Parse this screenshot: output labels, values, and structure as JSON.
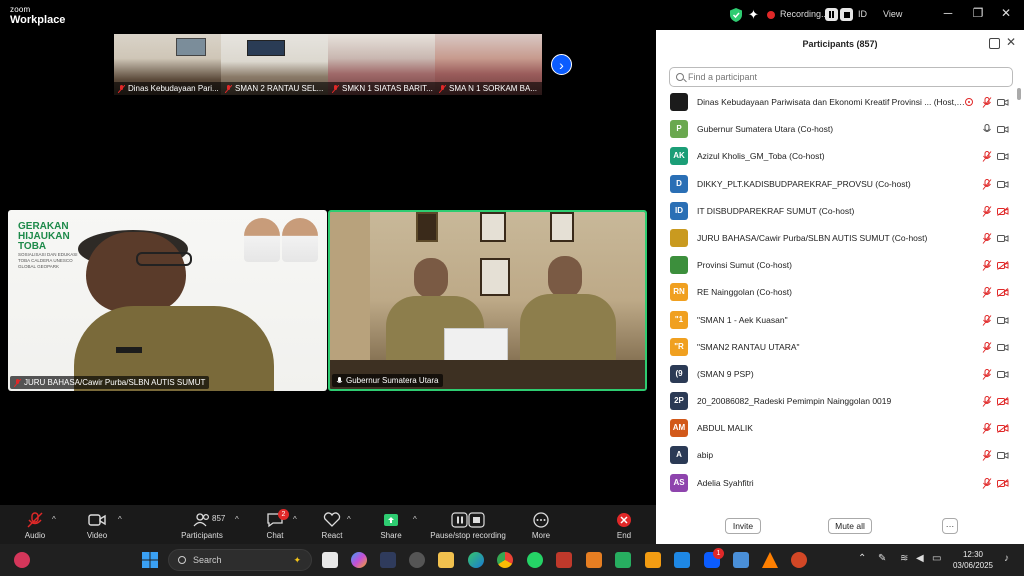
{
  "app": {
    "logo_line1": "zoom",
    "logo_line2": "Workplace"
  },
  "titlebar": {
    "recording_label": "Recording...",
    "id_label": "ID",
    "view_label": "View",
    "minimize": "─",
    "maximize": "❐",
    "close": "✕"
  },
  "filmstrip": [
    {
      "name": "Dinas Kebudayaan Pari..."
    },
    {
      "name": "SMAN 2 RANTAU SEL..."
    },
    {
      "name": "SMKN 1 SIATAS BARIT..."
    },
    {
      "name": "SMA N 1 SORKAM BA..."
    }
  ],
  "tiles": {
    "left": {
      "name": "JURU BAHASA/Cawir Purba/SLBN AUTIS SUMUT",
      "banner_line1": "GERAKAN",
      "banner_line2": "HIJAUKAN",
      "banner_line3": "TOBA",
      "banner_sub1": "SOSIALISASI DAN EDUKASI",
      "banner_sub2": "TOBA CALDERA UNESCO",
      "banner_sub3": "GLOBAL GEOPARK"
    },
    "right": {
      "name": "Gubernur Sumatera Utara"
    }
  },
  "toolbar": {
    "audio": "Audio",
    "video": "Video",
    "participants": "Participants",
    "participants_count": "857",
    "chat": "Chat",
    "chat_badge": "2",
    "react": "React",
    "share": "Share",
    "recording": "Pause/stop recording",
    "more": "More",
    "end": "End"
  },
  "panel": {
    "title": "Participants (857)",
    "search_placeholder": "Find a participant",
    "participants": [
      {
        "name": "Dinas Kebudayaan Pariwisata dan Ekonomi Kreatif Provinsi ... (Host, me)",
        "initials": "",
        "color": "#1b1b1b",
        "mic": "off",
        "cam": "on",
        "recording": true
      },
      {
        "name": "Gubernur Sumatera Utara (Co-host)",
        "initials": "P",
        "color": "#6aa84f",
        "mic": "on",
        "cam": "on"
      },
      {
        "name": "Azizul Kholis_GM_Toba (Co-host)",
        "initials": "AK",
        "color": "#1b9e77",
        "mic": "off",
        "cam": "on"
      },
      {
        "name": "DIKKY_PLT.KADISBUDPAREKRAF_PROVSU (Co-host)",
        "initials": "D",
        "color": "#2a6fb5",
        "mic": "off",
        "cam": "on"
      },
      {
        "name": "IT DISBUDPAREKRAF SUMUT (Co-host)",
        "initials": "ID",
        "color": "#2a6fb5",
        "mic": "off",
        "cam": "off"
      },
      {
        "name": "JURU BAHASA/Cawir Purba/SLBN AUTIS SUMUT (Co-host)",
        "initials": "",
        "color": "#c99a1f",
        "mic": "off",
        "cam": "on"
      },
      {
        "name": "Provinsi Sumut (Co-host)",
        "initials": "",
        "color": "#3c8f3c",
        "mic": "off",
        "cam": "off"
      },
      {
        "name": "RE Nainggolan (Co-host)",
        "initials": "RN",
        "color": "#f0a020",
        "mic": "off",
        "cam": "off"
      },
      {
        "name": "\"SMAN 1 - Aek Kuasan\"",
        "initials": "\"1",
        "color": "#f0a020",
        "mic": "off",
        "cam": "on"
      },
      {
        "name": "\"SMAN2 RANTAU UTARA\"",
        "initials": "\"R",
        "color": "#f0a020",
        "mic": "off",
        "cam": "on"
      },
      {
        "name": "(SMAN 9 PSP)",
        "initials": "(9",
        "color": "#2b3a55",
        "mic": "off",
        "cam": "on"
      },
      {
        "name": "20_20086082_Radeski Pemimpin Nainggolan 0019",
        "initials": "2P",
        "color": "#2b3a55",
        "mic": "off",
        "cam": "off"
      },
      {
        "name": "ABDUL MALIK",
        "initials": "AM",
        "color": "#d2591a",
        "mic": "off",
        "cam": "off"
      },
      {
        "name": "abip",
        "initials": "A",
        "color": "#2b3a55",
        "mic": "off",
        "cam": "on"
      },
      {
        "name": "Adelia Syahfitri",
        "initials": "AS",
        "color": "#8e44ad",
        "mic": "off",
        "cam": "off"
      }
    ],
    "invite": "Invite",
    "mute_all": "Mute all",
    "more": "···"
  },
  "taskbar": {
    "search": "Search",
    "time": "12:30",
    "date": "03/06/2025",
    "notification_badge": "1"
  }
}
